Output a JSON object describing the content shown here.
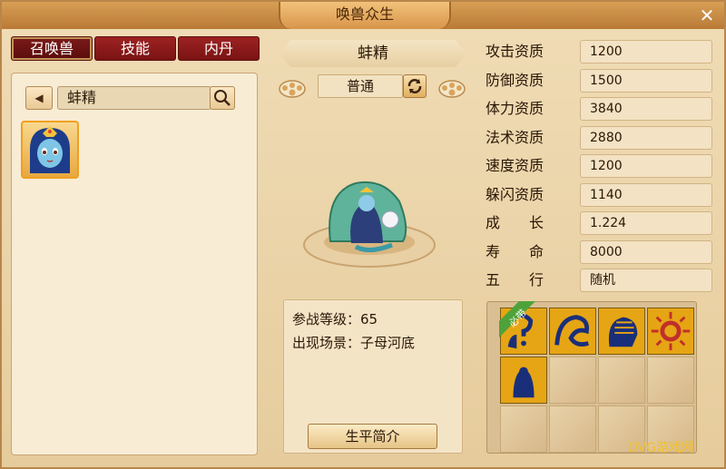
{
  "window": {
    "title": "唤兽众生",
    "close_label": "✕"
  },
  "tabs": [
    {
      "label": "召唤兽",
      "active": true
    },
    {
      "label": "技能",
      "active": false
    },
    {
      "label": "内丹",
      "active": false
    }
  ],
  "search": {
    "value": "蚌精",
    "back_label": "◀"
  },
  "pet": {
    "name": "蚌精",
    "grade": "普通",
    "info": {
      "level_label": "参战等级：",
      "level_value": "65",
      "location_label": "出现场景：",
      "location_value": "子母河底"
    },
    "bio_button": "生平简介"
  },
  "attributes": [
    {
      "label": "攻击资质",
      "value": "1200"
    },
    {
      "label": "防御资质",
      "value": "1500"
    },
    {
      "label": "体力资质",
      "value": "3840"
    },
    {
      "label": "法术资质",
      "value": "2880"
    },
    {
      "label": "速度资质",
      "value": "1200"
    },
    {
      "label": "躲闪资质",
      "value": "1140"
    },
    {
      "label": "成　　长",
      "value": "1.224"
    },
    {
      "label": "寿　　命",
      "value": "8000"
    },
    {
      "label": "五　　行",
      "value": "随机"
    }
  ],
  "skills": {
    "badge_label": "必带",
    "slots": [
      {
        "icon": "mystery-skill-icon",
        "filled": true
      },
      {
        "icon": "wave-skill-icon",
        "filled": true
      },
      {
        "icon": "mind-skill-icon",
        "filled": true
      },
      {
        "icon": "sun-skill-icon",
        "filled": true
      },
      {
        "icon": "cloak-skill-icon",
        "filled": true
      },
      {
        "icon": "",
        "filled": false
      },
      {
        "icon": "",
        "filled": false
      },
      {
        "icon": "",
        "filled": false
      },
      {
        "icon": "",
        "filled": false
      },
      {
        "icon": "",
        "filled": false
      },
      {
        "icon": "",
        "filled": false
      },
      {
        "icon": "",
        "filled": false
      }
    ]
  },
  "watermark": "DVG游戏网",
  "colors": {
    "tab_active": "#7c1a1a",
    "skill_gold": "#e6a514",
    "title_bar": "#c98a42"
  }
}
